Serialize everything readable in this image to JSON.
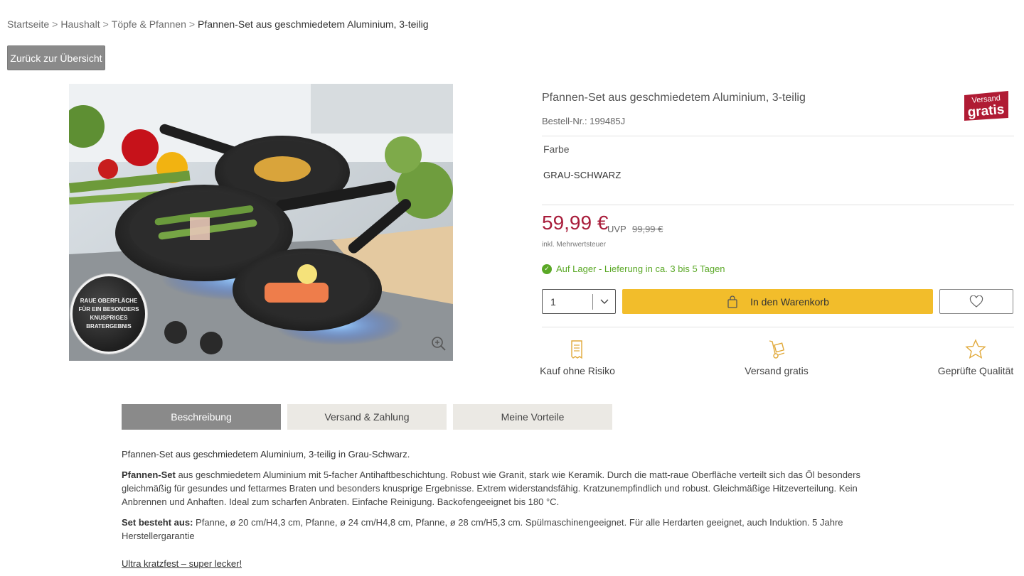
{
  "breadcrumb": {
    "items": [
      "Startseite",
      "Haushalt",
      "Töpfe & Pfannen"
    ],
    "separator": ">",
    "current": "Pfannen-Set aus geschmiedetem Aluminium, 3-teilig"
  },
  "back_button": "Zurück zur Übersicht",
  "image": {
    "seal_text": "RAUE OBERFLÄCHE FÜR EIN BESONDERS KNUSPRIGES BRATERGEBNIS",
    "zoom_icon": "zoom-in-icon"
  },
  "product": {
    "title": "Pfannen-Set aus geschmiedetem Aluminium, 3-teilig",
    "order_no": "Bestell-Nr.: 199485J",
    "badge": {
      "line1": "Versand",
      "line2": "gratis",
      "color": "#b01b34"
    },
    "color_label": "Farbe",
    "color_value": "GRAU-SCHWARZ",
    "price": "59,99 €",
    "uvp_label": "UVP",
    "uvp_value": "99,99 €",
    "vat": "inkl. Mehrwertsteuer",
    "stock": "Auf Lager - Lieferung in ca. 3 bis 5 Tagen",
    "quantity": "1",
    "cart_button": "In den Warenkorb",
    "price_color": "#a81c3a",
    "accent_color": "#f2bd2b",
    "stock_color": "#5aa826"
  },
  "usps": [
    {
      "label": "Kauf ohne Risiko",
      "icon": "receipt-icon"
    },
    {
      "label": "Versand gratis",
      "icon": "hand-truck-icon"
    },
    {
      "label": "Geprüfte Qualität",
      "icon": "star-icon"
    }
  ],
  "tabs": [
    {
      "label": "Beschreibung",
      "active": true
    },
    {
      "label": "Versand & Zahlung",
      "active": false
    },
    {
      "label": "Meine Vorteile",
      "active": false
    }
  ],
  "description": {
    "heading": "Pfannen-Set aus geschmiedetem Aluminium, 3-teilig in Grau-Schwarz.",
    "para1_lead": "Pfannen-Set",
    "para1_rest": " aus geschmiedetem Aluminium mit 5-facher Antihaftbeschichtung. Robust wie Granit, stark wie Keramik. Durch die matt-raue Oberfläche verteilt sich das Öl besonders gleichmäßig für gesundes und fettarmes Braten und besonders knusprige Ergebnisse. Extrem widerstandsfähig. Kratzunempfindlich und robust. Gleichmäßige Hitzeverteilung. Kein Anbrennen und Anhaften. Ideal zum scharfen Anbraten. Einfache Reinigung. Backofengeeignet bis 180 °C.",
    "para2_lead": "Set besteht aus:",
    "para2_rest": " Pfanne, ø 20 cm/H4,3 cm, Pfanne, ø 24 cm/H4,8 cm, Pfanne, ø 28 cm/H5,3 cm. Spülmaschinengeeignet. Für alle Herdarten geeignet, auch Induktion. 5 Jahre Herstellergarantie",
    "link": "Ultra kratzfest – super lecker!"
  }
}
